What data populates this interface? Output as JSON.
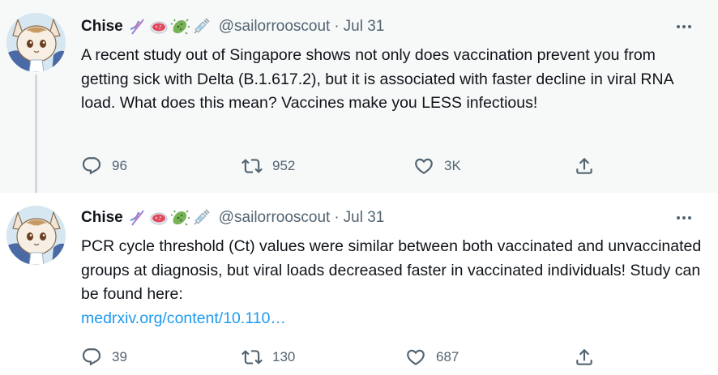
{
  "tweets": [
    {
      "name": "Chise",
      "handle": "@sailorrooscout",
      "separator": "·",
      "date": "Jul 31",
      "text": "A recent study out of Singapore shows not only does vaccination prevent you from getting sick with Delta (B.1.617.2), but it is associated with faster decline in viral RNA load. What does this mean? Vaccines make you LESS infectious!",
      "link": "",
      "replies": "96",
      "retweets": "952",
      "likes": "3K"
    },
    {
      "name": "Chise",
      "handle": "@sailorrooscout",
      "separator": "·",
      "date": "Jul 31",
      "text": "PCR cycle threshold (Ct) values were similar between both vaccinated and unvaccinated groups at diagnosis, but viral loads decreased faster in vaccinated individuals! Study can be found here:",
      "link": "medrxiv.org/content/10.110…",
      "replies": "39",
      "retweets": "130",
      "likes": "687"
    }
  ],
  "name_emojis": [
    "dna-icon",
    "petri-dish-icon",
    "microbe-icon",
    "syringe-icon"
  ],
  "colors": {
    "text": "#0f1419",
    "secondary": "#536471",
    "link": "#1d9bf0",
    "highlight_bg": "#f7f9f9"
  }
}
